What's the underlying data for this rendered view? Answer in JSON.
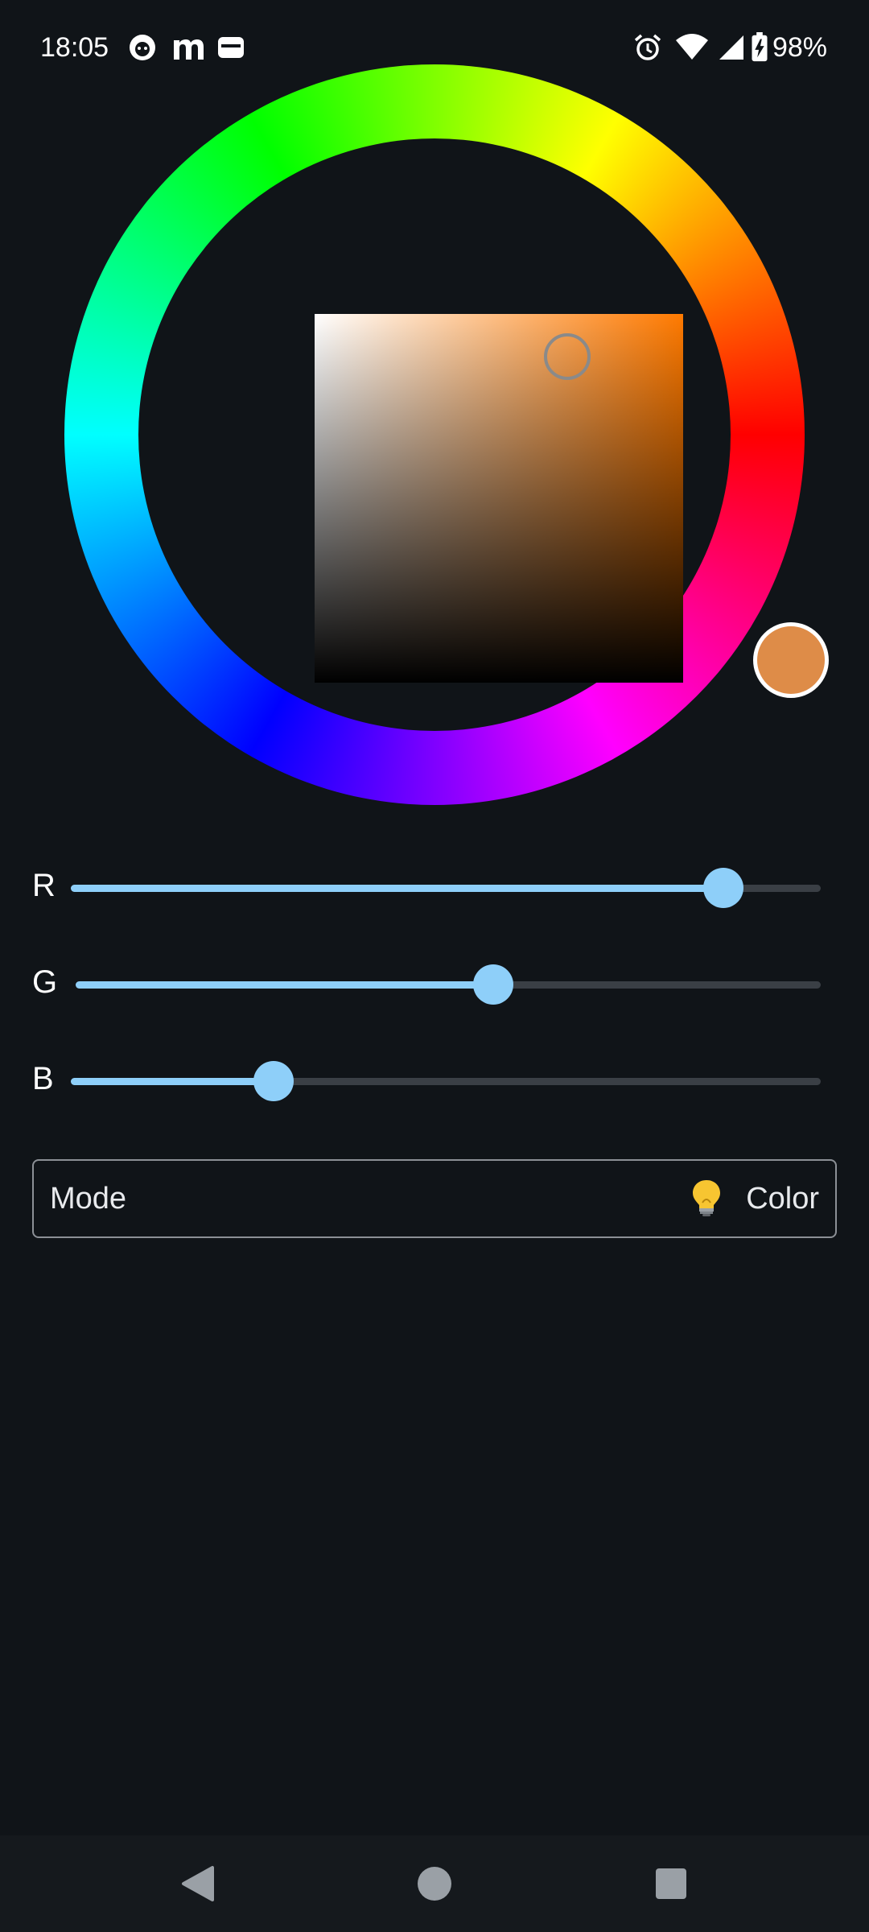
{
  "status_bar": {
    "time": "18:05",
    "battery_percent": "98%",
    "icons": [
      "cat-notification-icon",
      "m-app-icon",
      "wallet-icon",
      "alarm-icon",
      "wifi-icon",
      "signal-icon",
      "battery-charging-icon"
    ]
  },
  "color_picker": {
    "selected_color": "#de8c48",
    "hue_ring_colors": [
      "#ff0000",
      "#ff00ff",
      "#0000ff",
      "#00ffff",
      "#00ff00",
      "#ffff00"
    ],
    "square_hue_color": "#ff7a00"
  },
  "sliders": [
    {
      "label": "R",
      "fraction": 0.87
    },
    {
      "label": "G",
      "fraction": 0.56
    },
    {
      "label": "B",
      "fraction": 0.27
    }
  ],
  "mode": {
    "label": "Mode",
    "value": "Color",
    "icon": "lightbulb-icon"
  },
  "nav": {
    "buttons": [
      "back-icon",
      "home-icon",
      "recents-icon"
    ]
  }
}
